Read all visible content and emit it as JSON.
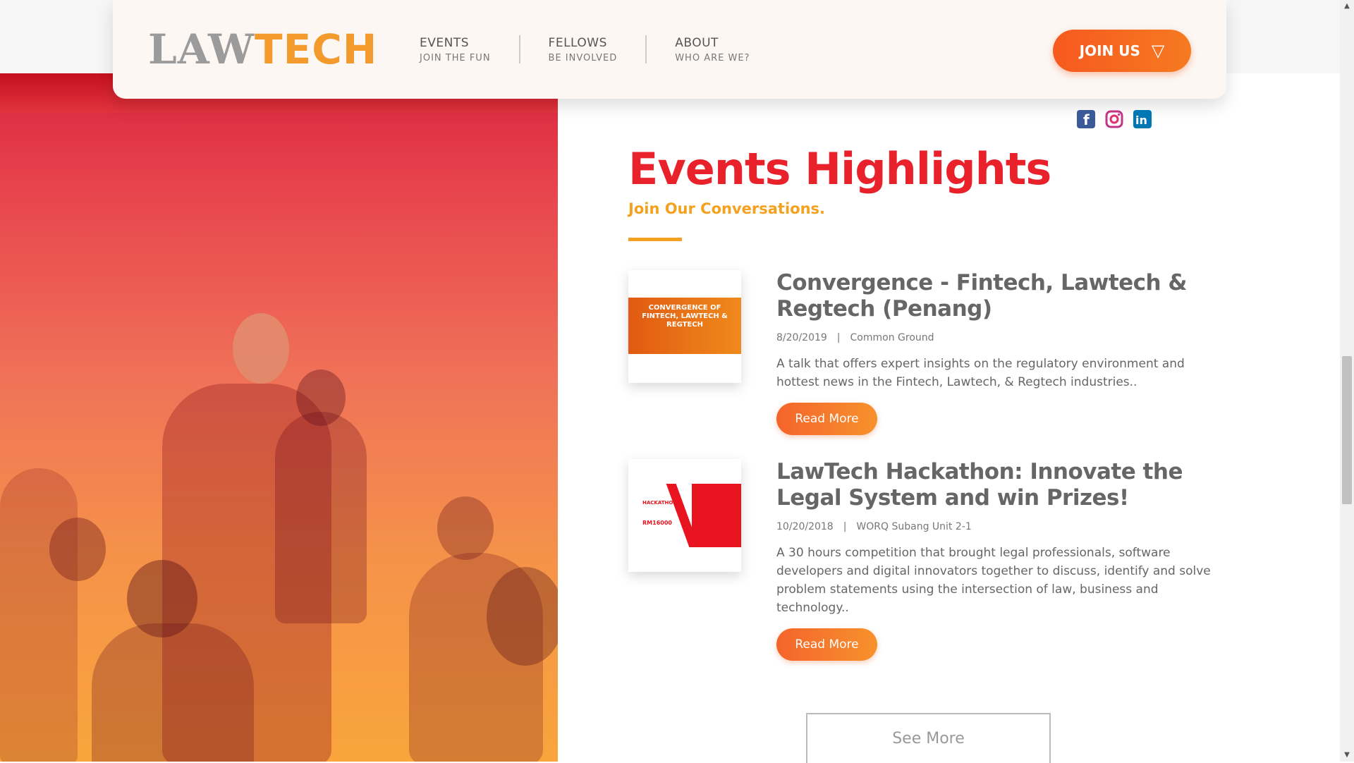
{
  "header": {
    "logo_left": "LAW",
    "logo_right": "TECH",
    "nav": [
      {
        "title": "EVENTS",
        "sub": "JOIN THE FUN"
      },
      {
        "title": "FELLOWS",
        "sub": "BE INVOLVED"
      },
      {
        "title": "ABOUT",
        "sub": "WHO ARE WE?"
      }
    ],
    "join_label": "JOIN US",
    "join_icon": "▽"
  },
  "social": {
    "facebook": "facebook-icon",
    "instagram": "instagram-icon",
    "linkedin": "linkedin-icon",
    "colors": {
      "facebook": "#3b5998",
      "instagram": "#c13584",
      "linkedin": "#0077b5"
    }
  },
  "section": {
    "title": "Events Highlights",
    "subtitle": "Join Our Conversations."
  },
  "events": [
    {
      "title": "Convergence - Fintech, Lawtech & Regtech (Penang)",
      "date": "8/20/2019",
      "separator": "|",
      "venue": "Common Ground",
      "description": "A talk that offers expert insights on the regulatory environment and hottest news in the Fintech, Lawtech, & Regtech industries..",
      "button": "Read More",
      "thumb_text": "CONVERGENCE OF FINTECH, LAWTECH & REGTECH"
    },
    {
      "title": "LawTech Hackathon: Innovate the Legal System and win Prizes!",
      "date": "10/20/2018",
      "separator": "|",
      "venue": "WORQ Subang Unit 2-1",
      "description": "A 30 hours competition that brought legal professionals, software developers and digital innovators together to discuss, identify and solve problem statements using the intersection of law, business and technology..",
      "button": "Read More",
      "thumb_text": "HACKATHON",
      "thumb_prize": "RM16000"
    }
  ],
  "see_more": "See More",
  "colors": {
    "accent_red": "#e8212b",
    "accent_orange": "#f3a11f",
    "button": "#f5642b"
  }
}
